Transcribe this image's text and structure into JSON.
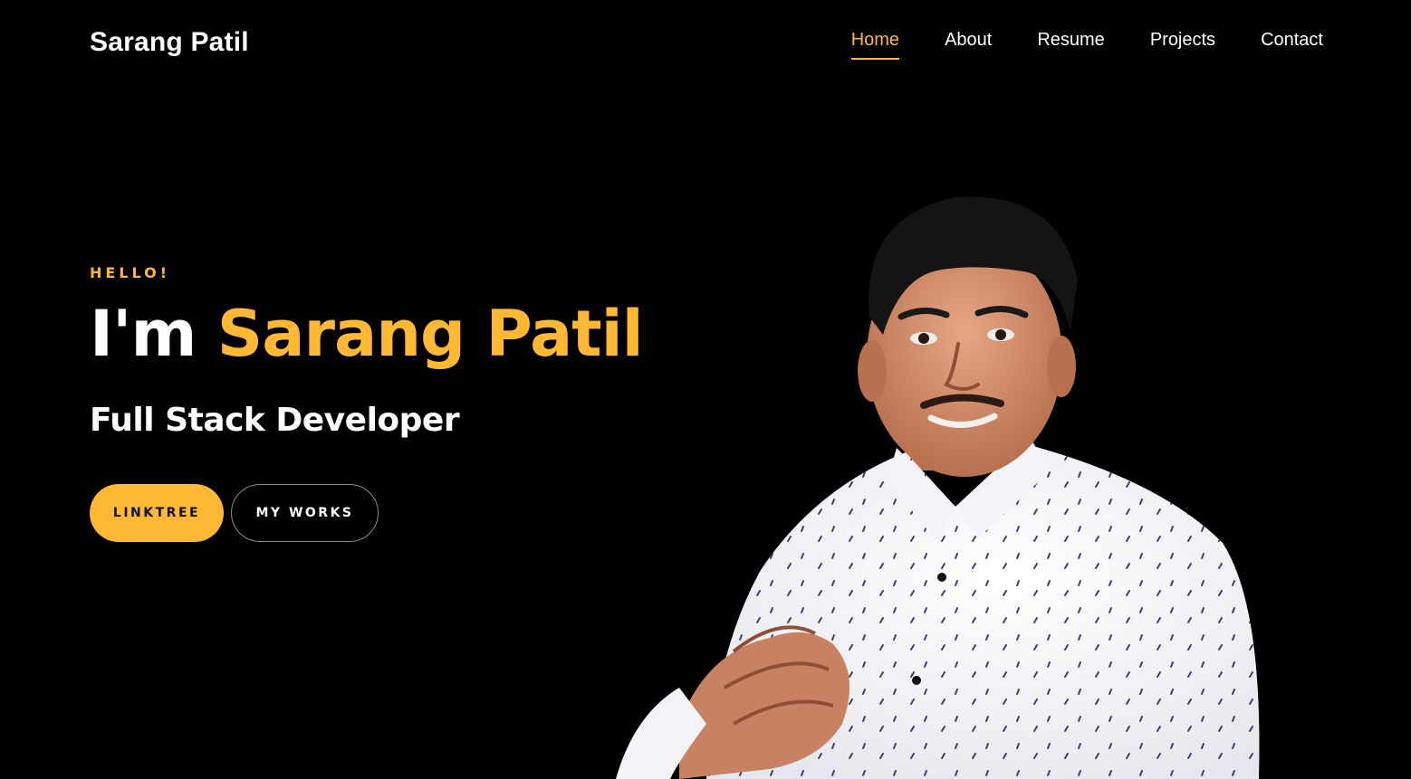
{
  "header": {
    "brand": "Sarang Patil",
    "nav": [
      {
        "label": "Home",
        "active": true
      },
      {
        "label": "About",
        "active": false
      },
      {
        "label": "Resume",
        "active": false
      },
      {
        "label": "Projects",
        "active": false
      },
      {
        "label": "Contact",
        "active": false
      }
    ]
  },
  "hero": {
    "greeting": "HELLO!",
    "headline_prefix": "I'm",
    "headline_name": "Sarang Patil",
    "role": "Full Stack Developer",
    "buttons": {
      "primary_label": "LINKTREE",
      "secondary_label": "MY WORKS"
    },
    "portrait": {
      "icon": "person-portrait-photo"
    }
  },
  "colors": {
    "background": "#000000",
    "accent": "#ffb834",
    "text": "#ffffff",
    "outline": "#8a8a8a"
  }
}
